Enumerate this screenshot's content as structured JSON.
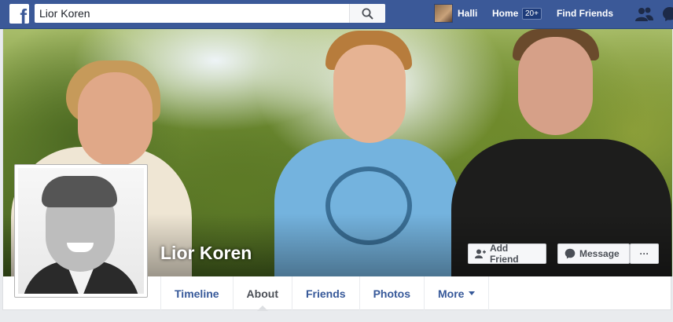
{
  "topbar": {
    "logo": "f",
    "search": {
      "value": "Lior Koren"
    },
    "user": {
      "name": "Halli"
    },
    "home": {
      "label": "Home",
      "count": "20+"
    },
    "find_friends": "Find Friends",
    "icons": [
      "facebook-logo-icon",
      "search-icon",
      "friend-requests-icon",
      "messenger-icon"
    ]
  },
  "profile": {
    "name": "Lior Koren",
    "buttons": {
      "add_friend": "Add Friend",
      "message": "Message",
      "more": "···"
    }
  },
  "tabs": [
    {
      "label": "Timeline",
      "active": false
    },
    {
      "label": "About",
      "active": true
    },
    {
      "label": "Friends",
      "active": false
    },
    {
      "label": "Photos",
      "active": false
    },
    {
      "label": "More",
      "active": false
    }
  ],
  "colors": {
    "brand": "#3b5998",
    "link": "#365899",
    "background": "#e9ebee"
  }
}
